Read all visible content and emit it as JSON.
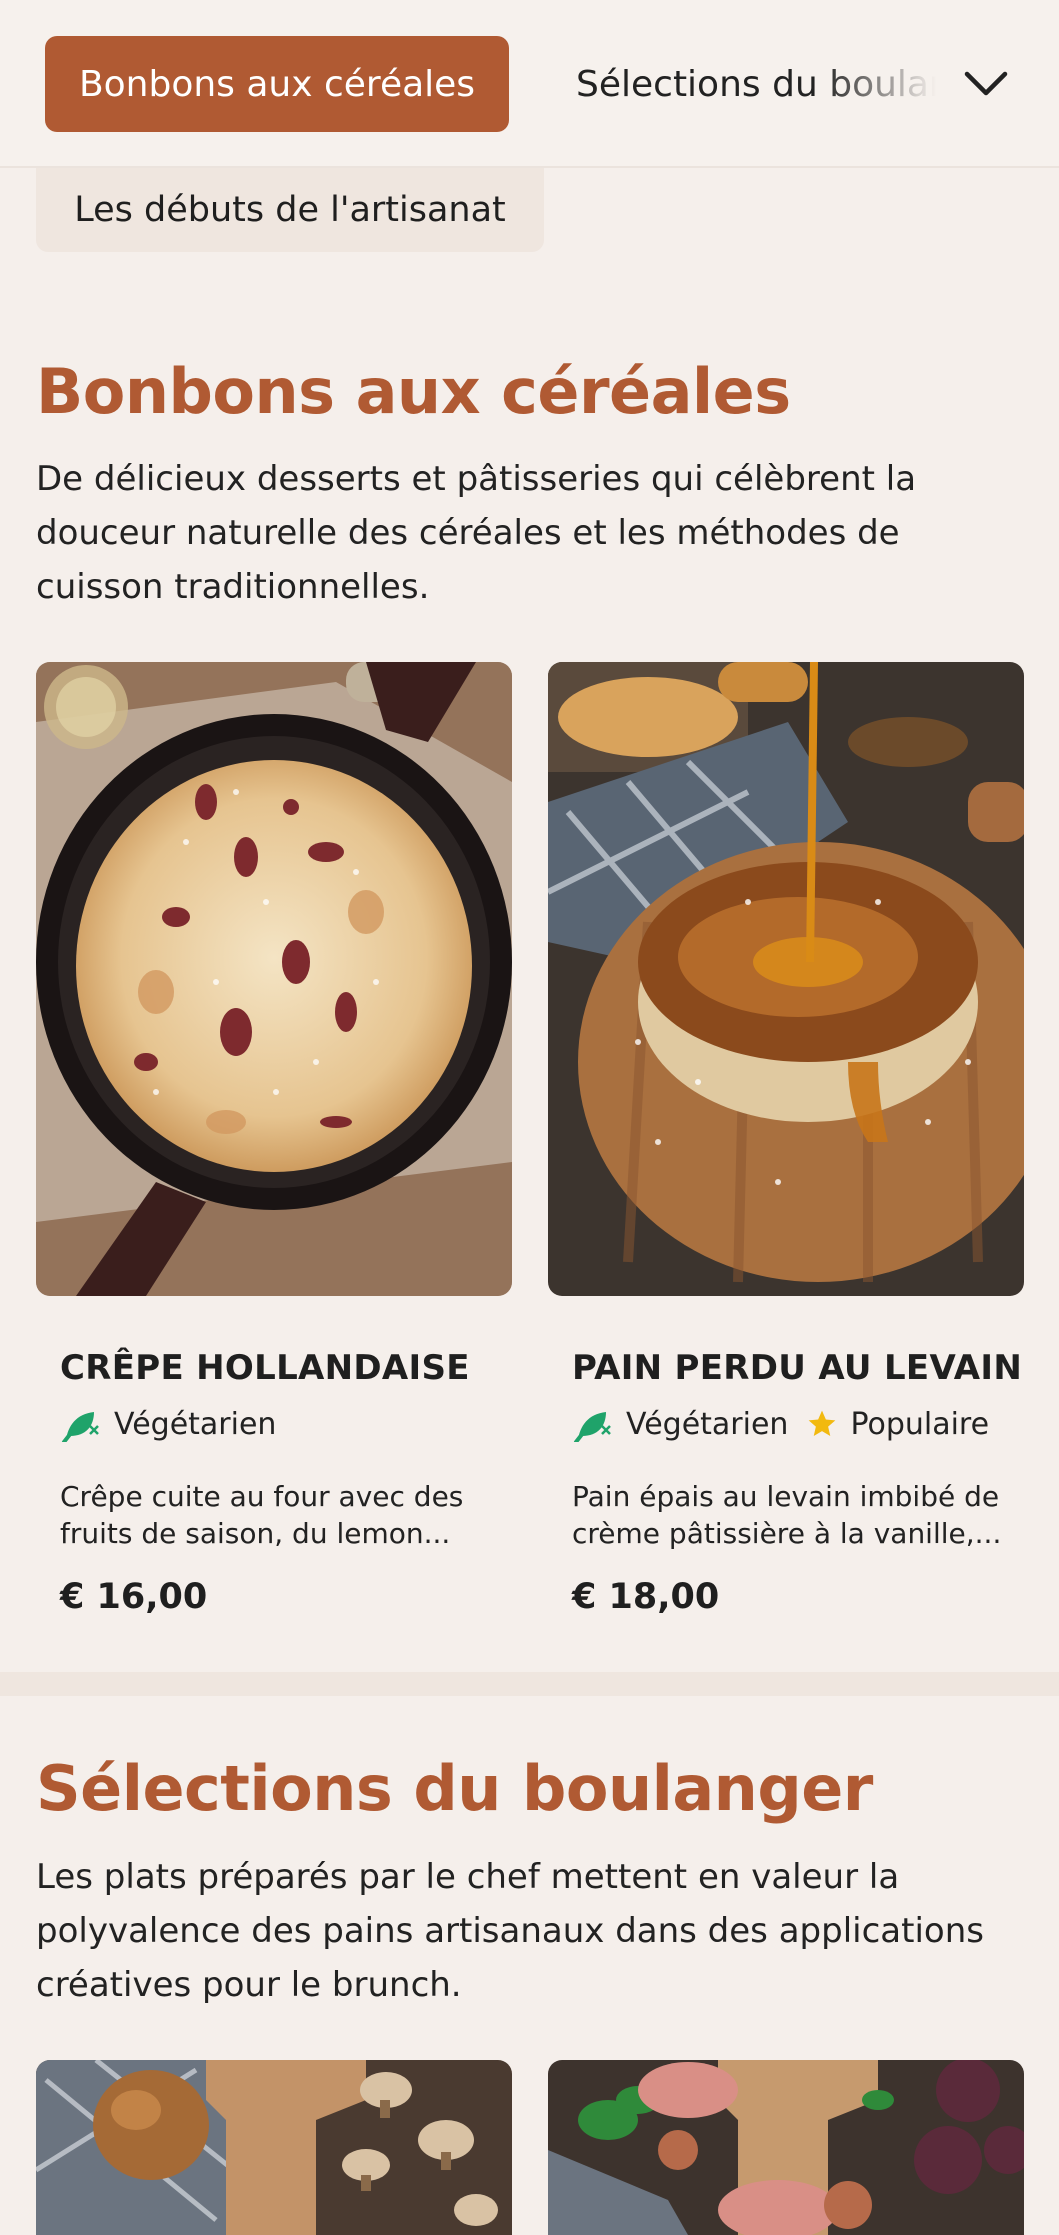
{
  "category_nav": {
    "active_label": "Bonbons aux céréales",
    "next_label": "Sélections du boulanger",
    "overflow_label": "Les débuts de l'artisanat",
    "chevron_icon": "chevron-down-icon"
  },
  "colors": {
    "accent": "#b05a33",
    "background": "#f5efeb",
    "vegetarian": "#1fa36a",
    "popular": "#f2b90f"
  },
  "sections": [
    {
      "title": "Bonbons aux céréales",
      "description": "De délicieux desserts et pâtisseries qui célèbrent la douceur naturelle des céréales et les méthodes de cuisson traditionnelles.",
      "items": [
        {
          "name": "CRÊPE HOLLANDAISE",
          "tags": [
            "Végétarien"
          ],
          "description_line1": "Crêpe cuite au four avec des",
          "description_line2": "fruits de saison, du lemon...",
          "price": "€ 16,00",
          "image_icon": "dutch-baby-pancake-photo"
        },
        {
          "name": "PAIN PERDU AU LEVAIN",
          "tags": [
            "Végétarien",
            "Populaire"
          ],
          "description_line1": "Pain épais au levain imbibé de",
          "description_line2": "crème pâtissière à la vanille,...",
          "price": "€ 18,00",
          "image_icon": "french-toast-photo"
        }
      ]
    },
    {
      "title": "Sélections du boulanger",
      "description": "Les plats préparés par le chef mettent en valeur la polyvalence des pains artisanaux dans des applications créatives pour le brunch.",
      "items": [
        {
          "image_icon": "mushroom-board-photo"
        },
        {
          "image_icon": "fig-prosciutto-board-photo"
        }
      ]
    }
  ]
}
